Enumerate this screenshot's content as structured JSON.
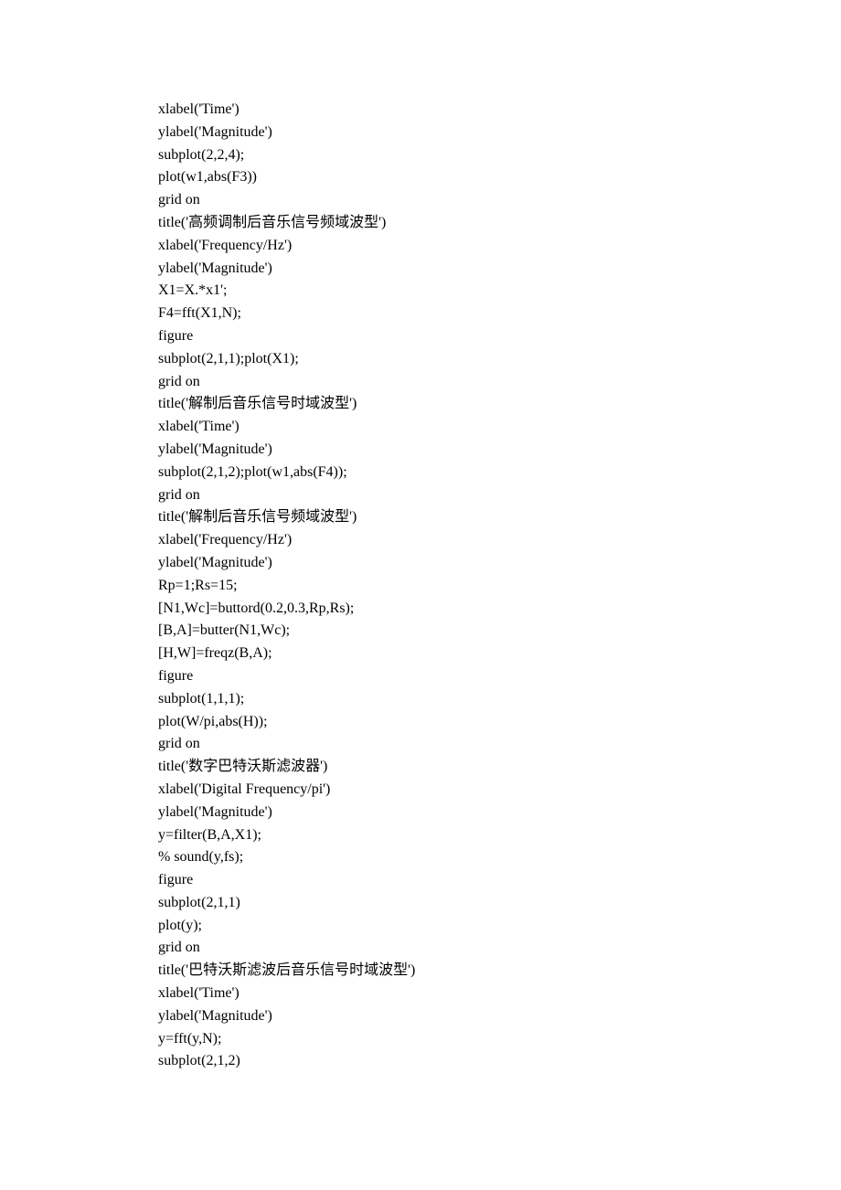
{
  "lines": [
    "xlabel('Time')",
    "ylabel('Magnitude')",
    "subplot(2,2,4);",
    "plot(w1,abs(F3))",
    "grid on",
    "title('高频调制后音乐信号频域波型')",
    "xlabel('Frequency/Hz')",
    "ylabel('Magnitude')",
    "X1=X.*x1';",
    "F4=fft(X1,N);",
    "figure",
    "subplot(2,1,1);plot(X1);",
    "grid on",
    "title('解制后音乐信号时域波型')",
    "xlabel('Time')",
    "ylabel('Magnitude')",
    "subplot(2,1,2);plot(w1,abs(F4));",
    "grid on",
    "title('解制后音乐信号频域波型')",
    "xlabel('Frequency/Hz')",
    "ylabel('Magnitude')",
    "Rp=1;Rs=15;",
    "[N1,Wc]=buttord(0.2,0.3,Rp,Rs);",
    "[B,A]=butter(N1,Wc);",
    "[H,W]=freqz(B,A);",
    "figure",
    "subplot(1,1,1);",
    "plot(W/pi,abs(H));",
    "grid on",
    "title('数字巴特沃斯滤波器')",
    "xlabel('Digital Frequency/pi')",
    "ylabel('Magnitude')",
    "",
    "y=filter(B,A,X1);",
    "% sound(y,fs);",
    "figure",
    "subplot(2,1,1)",
    "plot(y);",
    "grid on",
    "title('巴特沃斯滤波后音乐信号时域波型')",
    "xlabel('Time')",
    "ylabel('Magnitude')",
    "y=fft(y,N);",
    "subplot(2,1,2)"
  ]
}
